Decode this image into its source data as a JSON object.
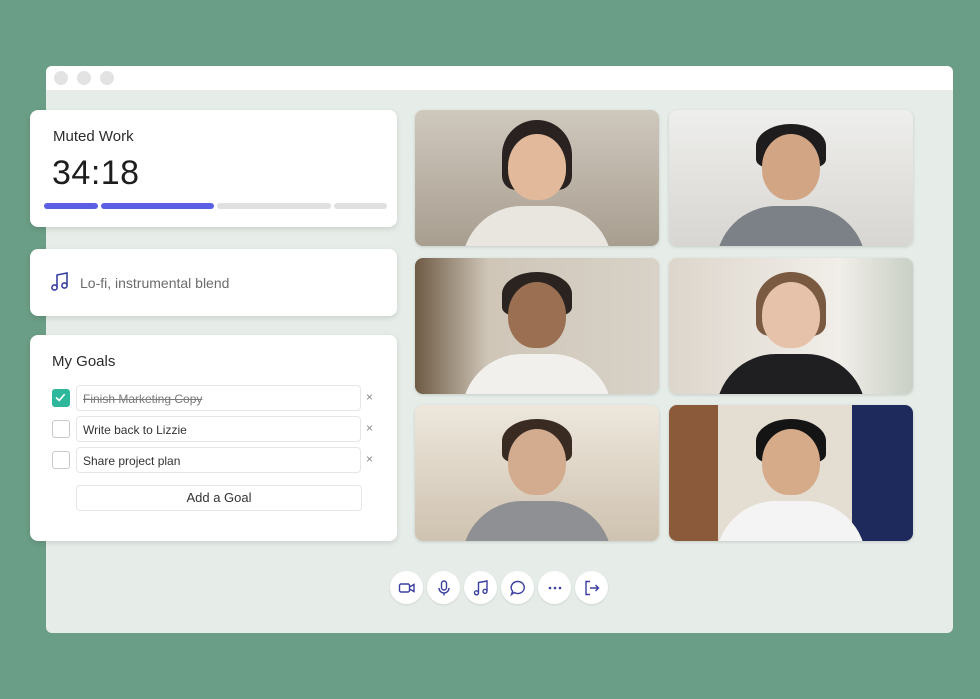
{
  "timer": {
    "title": "Muted Work",
    "time": "34:18",
    "accent": "#5b5fe6"
  },
  "music": {
    "label": "Lo-fi, instrumental blend",
    "icon": "music-note-icon"
  },
  "goals": {
    "title": "My Goals",
    "items": [
      {
        "label": "Finish Marketing Copy",
        "done": true
      },
      {
        "label": "Write back to Lizzie",
        "done": false
      },
      {
        "label": "Share project plan",
        "done": false
      }
    ],
    "remove_label": "×",
    "add_label": "Add a Goal"
  },
  "controls": [
    {
      "icon": "video-camera-icon"
    },
    {
      "icon": "microphone-icon"
    },
    {
      "icon": "music-note-icon"
    },
    {
      "icon": "chat-bubble-icon"
    },
    {
      "icon": "more-options-icon"
    },
    {
      "icon": "leave-icon"
    }
  ]
}
